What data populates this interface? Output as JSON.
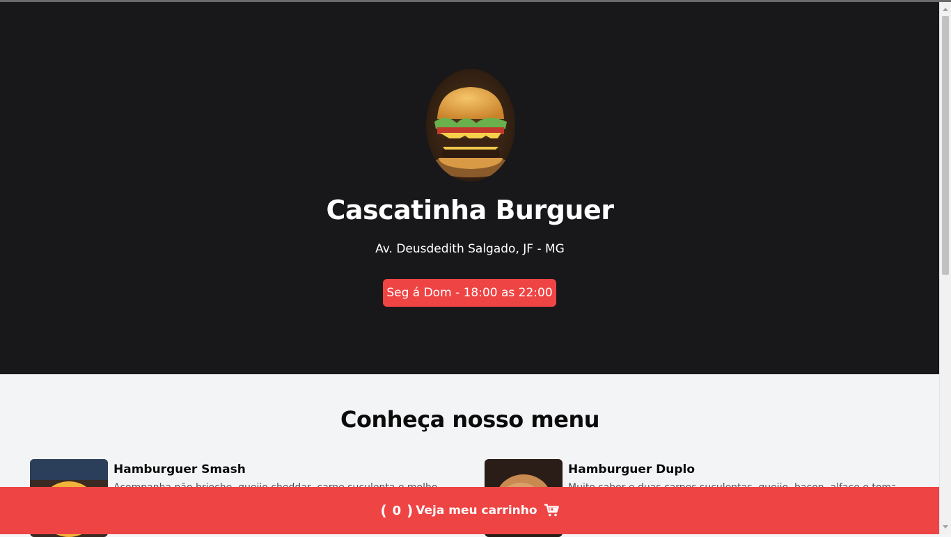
{
  "header": {
    "title": "Cascatinha Burguer",
    "address": "Av. Deusdedith Salgado, JF - MG",
    "hours": "Seg á Dom - 18:00 as 22:00"
  },
  "menu": {
    "title": "Conheça nosso menu",
    "items": [
      {
        "name": "Hamburguer Smash",
        "description": "Acompanha pão brioche, queijo cheddar, carne suculenta e molho especial da casa."
      },
      {
        "name": "Hamburguer Duplo",
        "description": "Muito sabor e duas carnes suculentas, queijo, bacon, alface e tomate fresco."
      }
    ]
  },
  "cart": {
    "open_paren": "(",
    "count": "0",
    "close_paren": ")",
    "label": "Veja meu carrinho",
    "icon": "cart-icon"
  },
  "colors": {
    "hero_bg": "#18181b",
    "accent": "#ef4444",
    "page_bg": "#f3f4f6"
  }
}
